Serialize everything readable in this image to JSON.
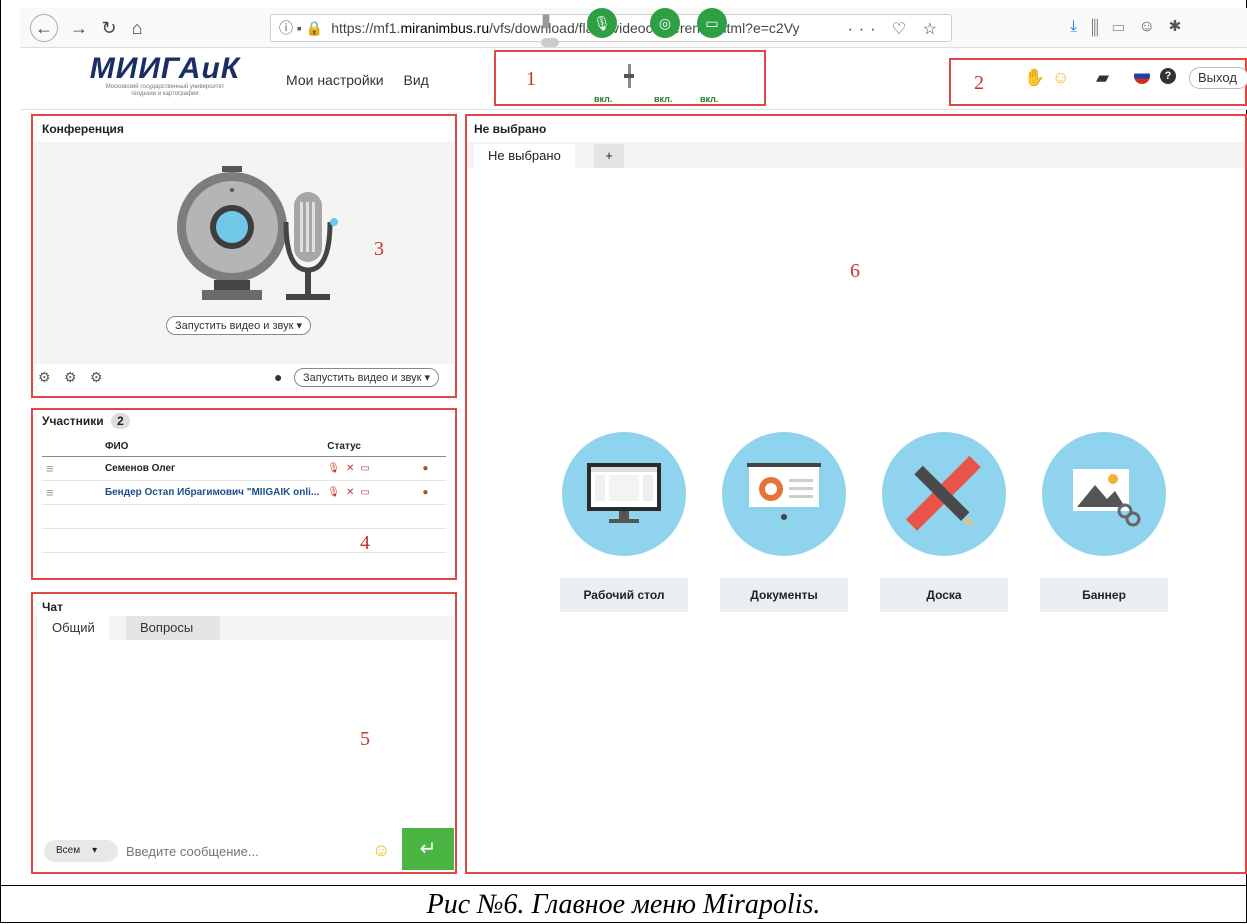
{
  "browser": {
    "url_prefix": "https://mf1.",
    "url_domain": "miranimbus.ru",
    "url_rest": "/vfs/download/flash/videoconference.html?e=c2Vy",
    "url_icons": "··· ♡ ☆"
  },
  "app": {
    "logo_main": "МИИГАиК",
    "logo_sub1": "Московский государственный университет",
    "logo_sub2": "геодезии и картографии",
    "menu": [
      "Мои настройки",
      "Вид"
    ],
    "controls": [
      "вкл.",
      "вкл.",
      "вкл."
    ],
    "exit_label": "Выход"
  },
  "labels": {
    "l1": "1",
    "l2": "2",
    "l3": "3",
    "l4": "4",
    "l5": "5",
    "l6": "6"
  },
  "conference": {
    "title": "Конференция",
    "start_center": "Запустить видео и звук ▾",
    "start_bottom": "Запустить видео и звук ▾"
  },
  "participants": {
    "title": "Участники",
    "count": "2",
    "col_name": "ФИО",
    "col_status": "Статус",
    "rows": [
      {
        "name": "Семенов Олег"
      },
      {
        "name": "Бендер Остап Ибрагимович \"MIIGAIK onli..."
      }
    ]
  },
  "chat": {
    "title": "Чат",
    "tabs": [
      "Общий",
      "Вопросы"
    ],
    "recipient": "Всем",
    "placeholder": "Введите сообщение..."
  },
  "workspace": {
    "title": "Не выбрано",
    "tab": "Не выбрано",
    "add_tab": "+",
    "tiles": [
      "Рабочий стол",
      "Документы",
      "Доска",
      "Баннер"
    ]
  },
  "caption": "Рис №6. Главное меню Mirapolis.",
  "colors": {
    "accent_green": "#2ea043",
    "highlight_red": "#e04848",
    "tile_blue": "#8fd3ee"
  }
}
